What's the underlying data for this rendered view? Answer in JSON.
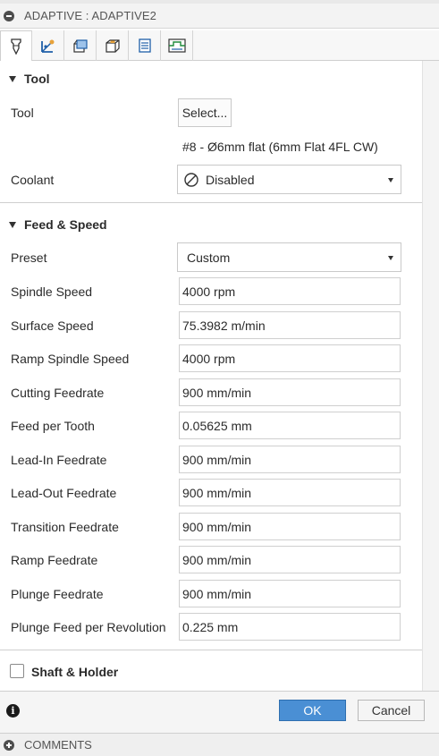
{
  "window": {
    "title": "ADAPTIVE : ADAPTIVE2"
  },
  "tabs": [
    {
      "name": "tool-tab-icon"
    },
    {
      "name": "geometry-tab-icon"
    },
    {
      "name": "heights-tab-icon"
    },
    {
      "name": "passes-tab-icon"
    },
    {
      "name": "linking-tab-icon"
    },
    {
      "name": "simulation-tab-icon"
    }
  ],
  "tool_section": {
    "title": "Tool",
    "tool_label": "Tool",
    "select_button": "Select...",
    "tool_name": "#8 - Ø6mm flat (6mm Flat 4FL CW)",
    "coolant_label": "Coolant",
    "coolant_value": "Disabled"
  },
  "feed_section": {
    "title": "Feed & Speed",
    "preset_label": "Preset",
    "preset_value": "Custom",
    "fields": [
      {
        "label": "Spindle Speed",
        "value": "4000 rpm"
      },
      {
        "label": "Surface Speed",
        "value": "75.3982 m/min"
      },
      {
        "label": "Ramp Spindle Speed",
        "value": "4000 rpm"
      },
      {
        "label": "Cutting Feedrate",
        "value": "900 mm/min"
      },
      {
        "label": "Feed per Tooth",
        "value": "0.05625 mm"
      },
      {
        "label": "Lead-In Feedrate",
        "value": "900 mm/min"
      },
      {
        "label": "Lead-Out Feedrate",
        "value": "900 mm/min"
      },
      {
        "label": "Transition Feedrate",
        "value": "900 mm/min"
      },
      {
        "label": "Ramp Feedrate",
        "value": "900 mm/min"
      },
      {
        "label": "Plunge Feedrate",
        "value": "900 mm/min"
      },
      {
        "label": "Plunge Feed per Revolution",
        "value": "0.225 mm"
      }
    ]
  },
  "shaft_section": {
    "title": "Shaft & Holder",
    "checked": false
  },
  "footer": {
    "ok": "OK",
    "cancel": "Cancel"
  },
  "comments": {
    "title": "COMMENTS"
  },
  "colors": {
    "ok_button": "#4a8fd4",
    "panel_bg": "#ffffff",
    "border": "#cfcfcf"
  }
}
